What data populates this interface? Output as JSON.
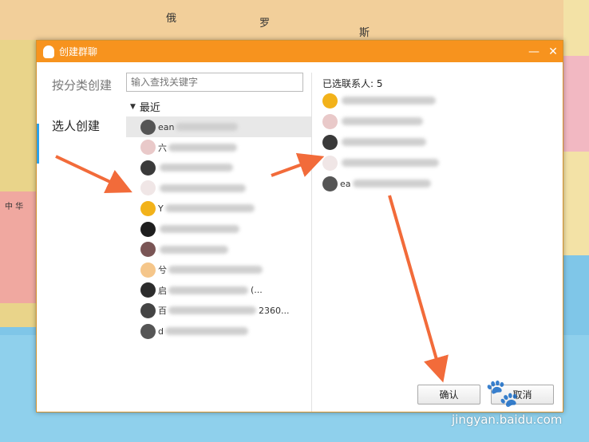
{
  "map_labels": [
    "俄",
    "罗",
    "斯",
    "中 华"
  ],
  "dialog": {
    "title": "创建群聊",
    "controls": {
      "minimize": "—",
      "close": "✕"
    },
    "nav": [
      {
        "label": "按分类创建",
        "selected": false
      },
      {
        "label": "选人创建",
        "selected": true
      }
    ],
    "search_placeholder": "输入查找关键字",
    "group_label": "最近",
    "contacts": [
      {
        "name": "ean",
        "highlighted": true,
        "avatar_color": "#555555"
      },
      {
        "name": "六",
        "highlighted": false,
        "avatar_color": "#e9c9c9"
      },
      {
        "name": "",
        "highlighted": false,
        "avatar_color": "#3a3a3a"
      },
      {
        "name": "",
        "highlighted": false,
        "avatar_color": "#f0e6e6"
      },
      {
        "name": "Y",
        "highlighted": false,
        "avatar_color": "#f2b21a"
      },
      {
        "name": "",
        "highlighted": false,
        "avatar_color": "#1e1e1e"
      },
      {
        "name": "",
        "highlighted": false,
        "avatar_color": "#7a5555"
      },
      {
        "name": "兮",
        "highlighted": false,
        "avatar_color": "#f5c68a"
      },
      {
        "name": "启",
        "highlighted": false,
        "avatar_color": "#2c2c2c",
        "suffix": "(..."
      },
      {
        "name": "百",
        "highlighted": false,
        "avatar_color": "#444444",
        "suffix": "2360..."
      },
      {
        "name": "d",
        "highlighted": false,
        "avatar_color": "#555555"
      }
    ],
    "selected_header": "已选联系人: 5",
    "selected": [
      {
        "name": "",
        "avatar_color": "#f2b21a"
      },
      {
        "name": "",
        "avatar_color": "#e9c9c9"
      },
      {
        "name": "",
        "avatar_color": "#3a3a3a"
      },
      {
        "name": "",
        "avatar_color": "#f0e6e6"
      },
      {
        "name": "ea",
        "avatar_color": "#555555"
      }
    ],
    "confirm_label": "确认",
    "cancel_label": "取消"
  },
  "watermark": "jingyan.baidu.com",
  "colors": {
    "titlebar": "#f7931e",
    "arrow": "#f26b3a",
    "nav_indicator": "#2aa0e8"
  }
}
